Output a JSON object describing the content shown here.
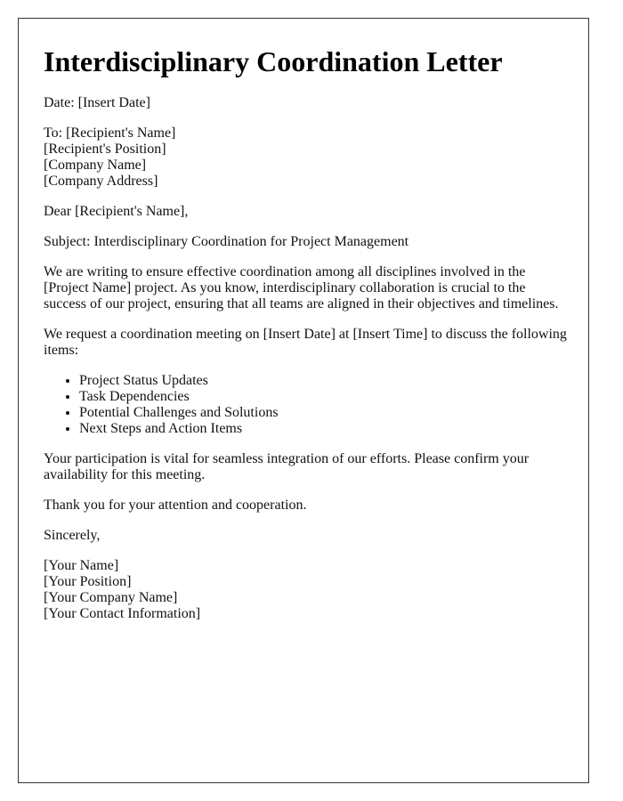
{
  "document": {
    "title": "Interdisciplinary Coordination Letter",
    "date_line": "Date: [Insert Date]",
    "recipient": [
      "To: [Recipient's Name]",
      "[Recipient's Position]",
      "[Company Name]",
      "[Company Address]"
    ],
    "salutation": "Dear [Recipient's Name],",
    "subject": "Subject: Interdisciplinary Coordination for Project Management",
    "paragraphs": [
      "We are writing to ensure effective coordination among all disciplines involved in the [Project Name] project. As you know, interdisciplinary collaboration is crucial to the success of our project, ensuring that all teams are aligned in their objectives and timelines.",
      "We request a coordination meeting on [Insert Date] at [Insert Time] to discuss the following items:"
    ],
    "agenda_items": [
      "Project Status Updates",
      "Task Dependencies",
      "Potential Challenges and Solutions",
      "Next Steps and Action Items"
    ],
    "closing_paragraphs": [
      "Your participation is vital for seamless integration of our efforts. Please confirm your availability for this meeting.",
      "Thank you for your attention and cooperation."
    ],
    "signoff": "Sincerely,",
    "signature": [
      "[Your Name]",
      "[Your Position]",
      "[Your Company Name]",
      "[Your Contact Information]"
    ]
  }
}
